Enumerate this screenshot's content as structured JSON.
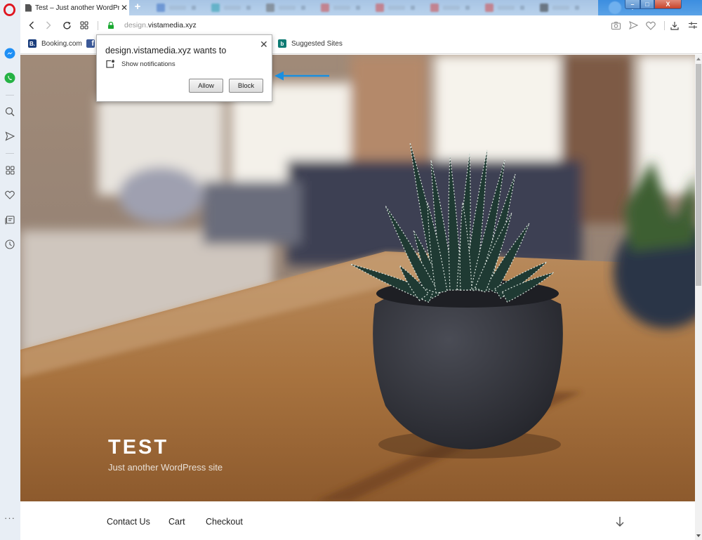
{
  "browser": {
    "name": "Opera",
    "active_tab": {
      "title": "Test – Just another WordPress site",
      "icon": "document-icon"
    },
    "new_tab_label": "+",
    "background_tabs": [
      {
        "favicon_color": "#3a6fc4"
      },
      {
        "favicon_color": "#2a9fb0"
      },
      {
        "favicon_color": "#666666"
      },
      {
        "favicon_color": "#d24a4a"
      },
      {
        "favicon_color": "#d24a4a"
      },
      {
        "favicon_color": "#d24a4a"
      },
      {
        "favicon_color": "#d24a4a"
      },
      {
        "favicon_color": "#333333"
      }
    ],
    "window_controls": {
      "minimize": "–",
      "maximize": "□",
      "close": "X"
    }
  },
  "address_bar": {
    "url_subdomain": "design.",
    "url_domain": "vistamedia.xyz",
    "secure": true,
    "icons": [
      "back-icon",
      "forward-icon",
      "reload-icon",
      "speed-dial-icon",
      "lock-icon",
      "snapshot-icon",
      "send-icon",
      "heart-icon",
      "download-icon",
      "easy-setup-icon"
    ]
  },
  "bookmarks": [
    {
      "label": "Booking.com",
      "icon_text": "B.",
      "color": "#1a3d7c"
    },
    {
      "label": "",
      "icon_text": "f",
      "color": "#3b5998"
    },
    {
      "label": "Suggested Sites",
      "icon_text": "b",
      "color": "#0f7b74"
    }
  ],
  "sidebar": {
    "items": [
      "messenger-icon",
      "whatsapp-icon",
      "search-icon",
      "send-icon",
      "speed-dial-icon",
      "heart-icon",
      "news-icon",
      "history-icon"
    ],
    "more_label": "···"
  },
  "permission_popup": {
    "title": "design.vistamedia.xyz wants to",
    "permission": "Show notifications",
    "allow_label": "Allow",
    "block_label": "Block",
    "close_label": "✕"
  },
  "annotation": {
    "arrow_color": "#1a8fe0"
  },
  "site": {
    "title": "TEST",
    "tagline": "Just another WordPress site",
    "nav": [
      "Contact Us",
      "Cart",
      "Checkout"
    ]
  }
}
